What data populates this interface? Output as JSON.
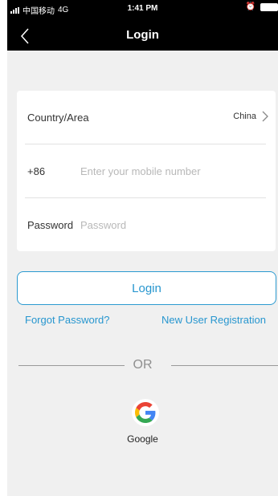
{
  "status_bar": {
    "carrier": "中国移动",
    "network": "4G",
    "time": "1:41 PM"
  },
  "nav": {
    "title": "Login"
  },
  "form": {
    "country_label": "Country/Area",
    "country_value": "China",
    "phone_prefix": "+86",
    "phone_placeholder": "Enter your mobile number",
    "password_label": "Password",
    "password_placeholder": "Password"
  },
  "actions": {
    "login_label": "Login",
    "forgot_label": "Forgot Password?",
    "register_label": "New User Registration"
  },
  "divider": {
    "or_label": "OR"
  },
  "social": {
    "google_label": "Google"
  },
  "colors": {
    "accent": "#2796cf",
    "background": "#f0f0f0"
  },
  "icons": [
    "back-chevron-icon",
    "chevron-right-icon",
    "google-icon",
    "signal-icon",
    "alarm-icon",
    "battery-icon"
  ]
}
